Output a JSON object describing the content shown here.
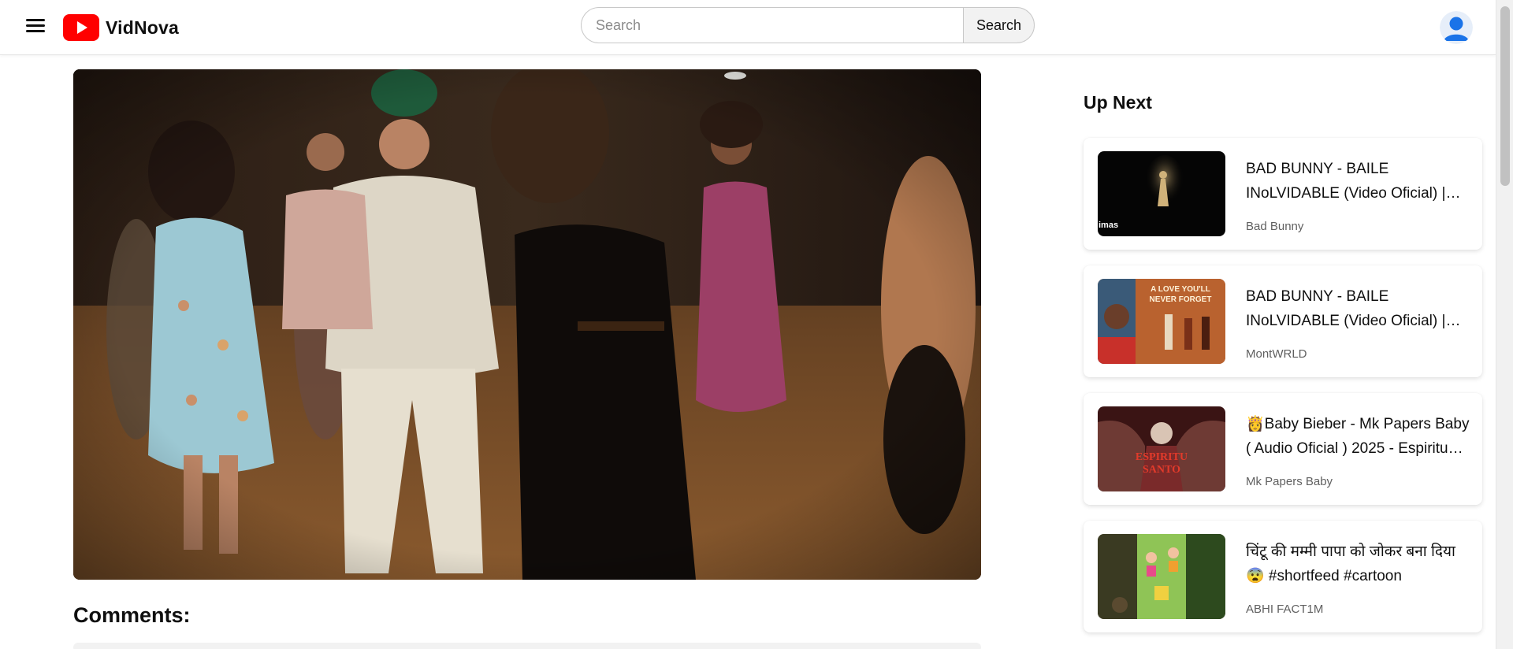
{
  "app": {
    "name": "VidNova",
    "brand_color": "#ff0000"
  },
  "header": {
    "menu_icon": "hamburger-menu-icon",
    "search": {
      "placeholder": "Search",
      "value": "",
      "button_label": "Search"
    },
    "avatar_icon": "user-avatar-icon"
  },
  "main": {
    "video": {
      "description": "music video frame"
    },
    "comments_title": "Comments:"
  },
  "sidebar": {
    "title": "Up Next",
    "items": [
      {
        "title": "BAD BUNNY - BAILE INoLVIDABLE (Video Oficial) | DeBÍ TiRAR MáS FOToS",
        "channel": "Bad Bunny",
        "thumb_text": "imas"
      },
      {
        "title": "BAD BUNNY - BAILE INoLVIDABLE (Video Oficial) | REACTION",
        "channel": "MontWRLD",
        "thumb_text": "A LOVE YOU'LL NEVER FORGET"
      },
      {
        "title": "👸Baby Bieber - Mk Papers Baby ( Audio Oficial ) 2025 - Espiritu Santo",
        "channel": "Mk Papers Baby",
        "thumb_text": "ESPIRITU SANTO"
      },
      {
        "title": "चिंटू की मम्मी पापा को जोकर बना दिया😨 #shortfeed #cartoon",
        "channel": "ABHI FACT1M",
        "thumb_text": ""
      }
    ]
  }
}
